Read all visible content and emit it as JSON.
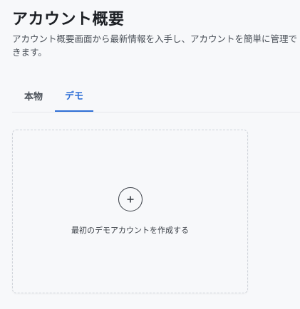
{
  "header": {
    "title": "アカウント概要",
    "subtitle": "アカウント概要画面から最新情報を入手し、アカウントを簡単に管理できます。"
  },
  "tabs": [
    {
      "label": "本物",
      "active": false
    },
    {
      "label": "デモ",
      "active": true
    }
  ],
  "create_card": {
    "icon": "plus-circle-icon",
    "label": "最初のデモアカウントを作成する"
  },
  "colors": {
    "accent": "#2f6fd6",
    "background": "#f7f8fa",
    "title": "#1c1f24",
    "muted_text": "#4a5058",
    "dashed_border": "#d0d4da"
  }
}
